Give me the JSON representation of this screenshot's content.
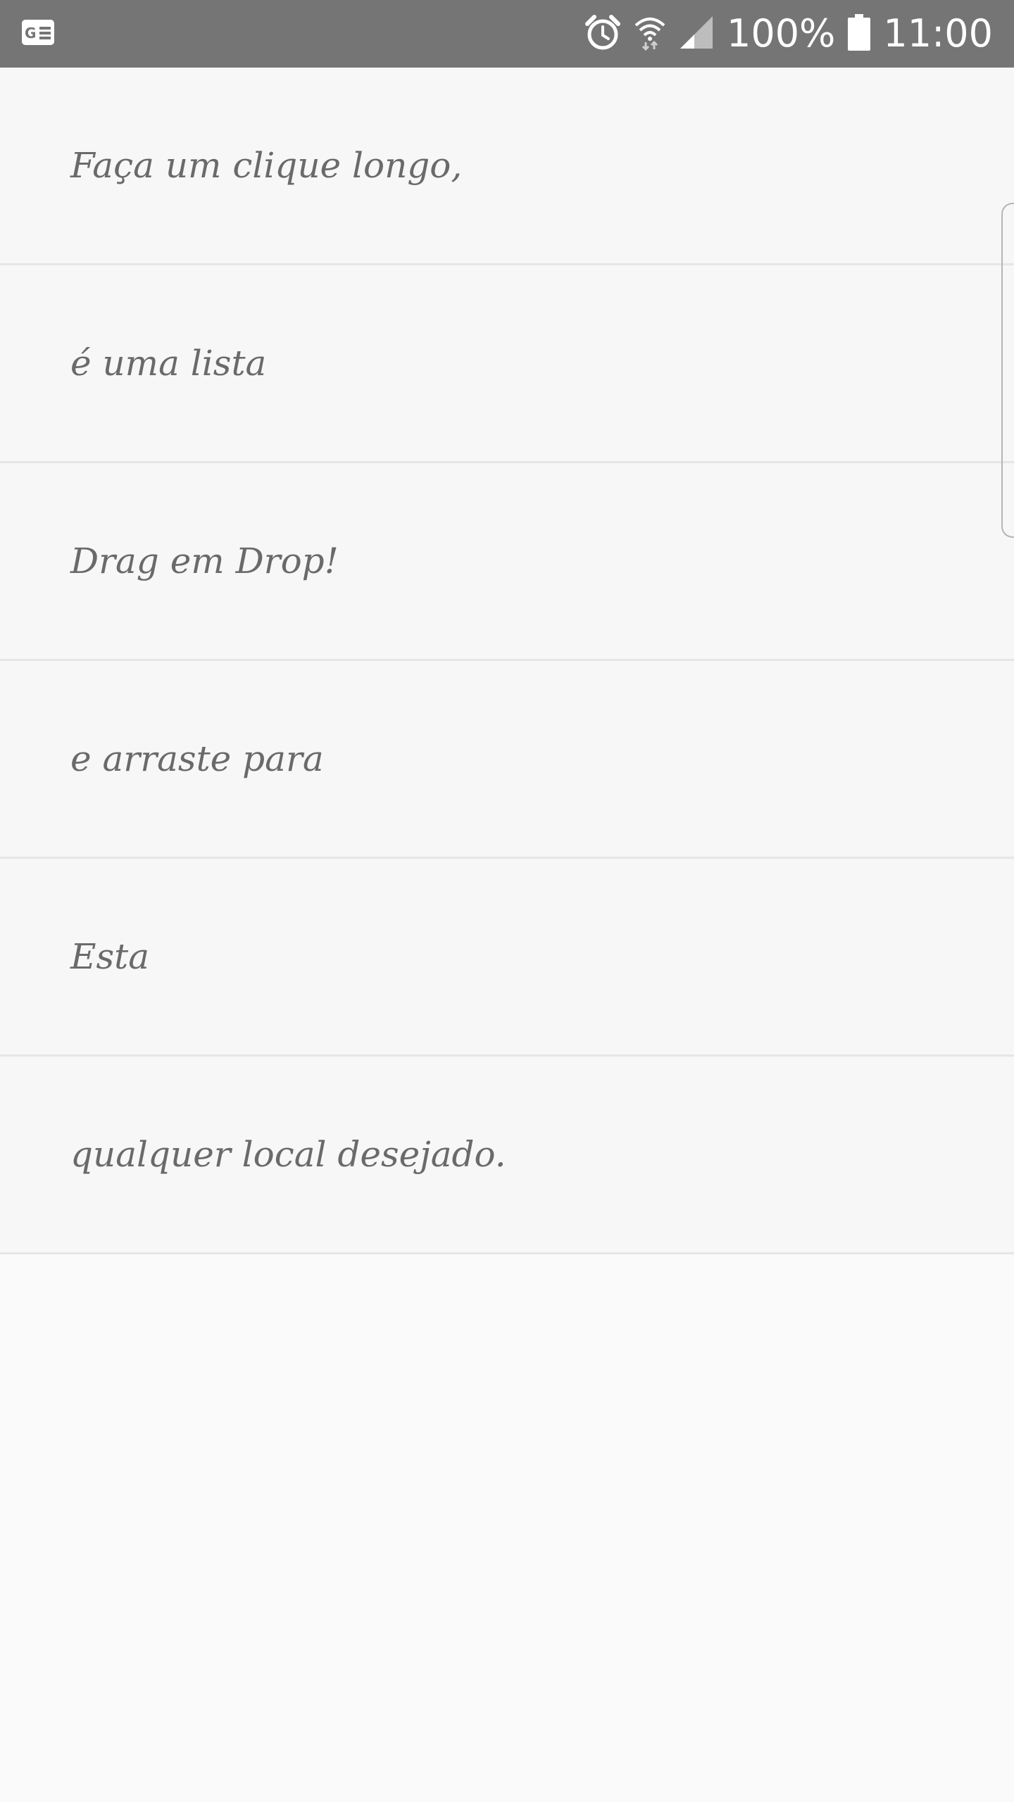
{
  "status_bar": {
    "notification_icon": "news-card-icon",
    "alarm_icon": "alarm-icon",
    "wifi_icon": "wifi-icon",
    "signal_icon": "cell-signal-icon",
    "battery_percent": "100%",
    "battery_icon": "battery-icon",
    "time": "11:00"
  },
  "list": {
    "items": [
      {
        "label": "Faça um clique longo,"
      },
      {
        "label": "é uma lista"
      },
      {
        "label": "Drag em Drop!"
      },
      {
        "label": "e arraste para"
      },
      {
        "label": "Esta"
      },
      {
        "label": "qualquer local desejado."
      }
    ]
  },
  "colors": {
    "status_bar_bg": "#757575",
    "background": "#fafafa",
    "item_bg": "#f7f7f7",
    "divider": "#e6e6e6",
    "text": "#6a6a6a"
  }
}
